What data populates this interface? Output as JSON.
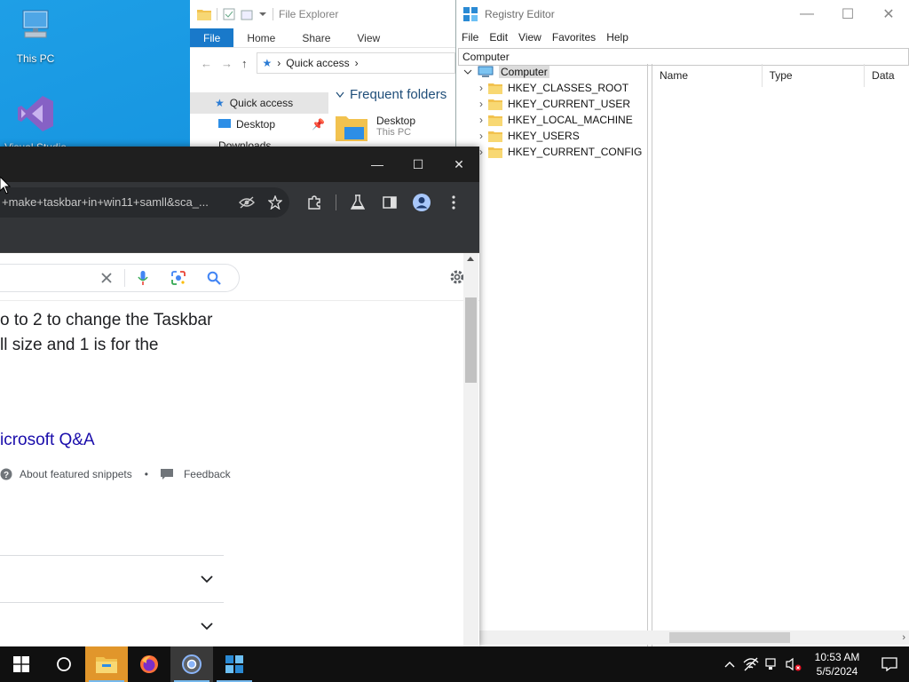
{
  "desktop": {
    "icons": [
      {
        "label": "This PC",
        "icon": "this-pc-icon"
      },
      {
        "label": "Visual Studio",
        "icon": "visual-studio-icon"
      }
    ]
  },
  "explorer": {
    "title": "File Explorer",
    "ribbon_tabs": [
      "File",
      "Home",
      "Share",
      "View"
    ],
    "address": "Quick access",
    "nav": [
      {
        "label": "Quick access"
      },
      {
        "label": "Desktop"
      },
      {
        "label": "Downloads"
      }
    ],
    "heading": "Frequent folders",
    "folder": {
      "name": "Desktop",
      "location": "This PC"
    }
  },
  "regedit": {
    "title": "Registry Editor",
    "menu": [
      "File",
      "Edit",
      "View",
      "Favorites",
      "Help"
    ],
    "address": "Computer",
    "tree_root": "Computer",
    "tree_children": [
      "HKEY_CLASSES_ROOT",
      "HKEY_CURRENT_USER",
      "HKEY_LOCAL_MACHINE",
      "HKEY_USERS",
      "HKEY_CURRENT_CONFIG"
    ],
    "columns": [
      "Name",
      "Type",
      "Data"
    ]
  },
  "chrome": {
    "url": "+make+taskbar+in+win11+samll&sca_...",
    "snippet_lines": [
      "o to 2 to change the Taskbar",
      "ll size and 1 is for the"
    ],
    "source_title": "icrosoft Q&A",
    "about_snippets": "About featured snippets",
    "bullet": "•",
    "feedback": "Feedback"
  },
  "taskbar": {
    "time": "10:53 AM",
    "date": "5/5/2024"
  },
  "colors": {
    "desktop_blue": "#0b86d8",
    "chrome_dark": "#1f1f1f",
    "chrome_toolbar": "#333538",
    "link": "#1a0dab",
    "google_blue": "#4285f4",
    "taskbar": "#101010"
  }
}
